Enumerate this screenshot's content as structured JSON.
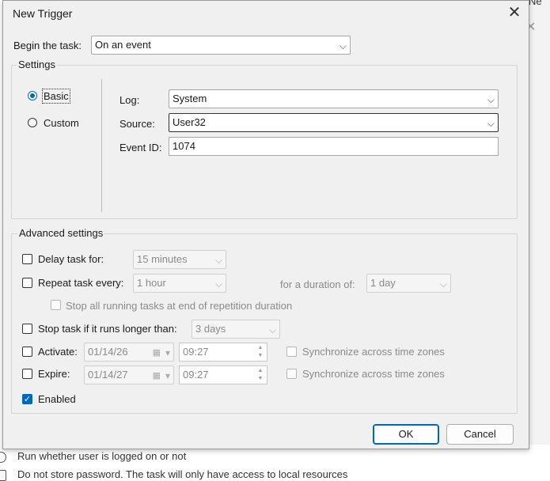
{
  "dialog": {
    "title": "New Trigger",
    "close_label": "✕",
    "begin_task_label": "Begin the task:",
    "begin_task_value": "On an event"
  },
  "settings": {
    "group_label": "Settings",
    "radio_basic": "Basic",
    "radio_custom": "Custom",
    "log_label": "Log:",
    "log_value": "System",
    "source_label": "Source:",
    "source_value": "User32",
    "event_id_label": "Event ID:",
    "event_id_value": "1074"
  },
  "advanced": {
    "group_label": "Advanced settings",
    "delay_label": "Delay task for:",
    "delay_value": "15 minutes",
    "repeat_label": "Repeat task every:",
    "repeat_value": "1 hour",
    "duration_label": "for a duration of:",
    "duration_value": "1 day",
    "stop_running_label": "Stop all running tasks at end of repetition duration",
    "stop_longer_label": "Stop task if it runs longer than:",
    "stop_longer_value": "3 days",
    "activate_label": "Activate:",
    "activate_date": "01/14/26",
    "activate_time": "09:27",
    "expire_label": "Expire:",
    "expire_date": "01/14/27",
    "expire_time": "09:27",
    "sync_label": "Synchronize across time zones",
    "enabled_label": "Enabled",
    "enabled_checked": true
  },
  "buttons": {
    "ok": "OK",
    "cancel": "Cancel"
  },
  "background": {
    "run_whether_text": "Run whether user is logged on or not",
    "do_not_store_text": "Do not store password.  The task will only have access to local resources",
    "corner_text": "Ne"
  },
  "icons": {
    "chevron": "chevron-down-icon",
    "calendar": "calendar-icon",
    "check": "checkmark-icon"
  },
  "colors": {
    "accent": "#0067c0",
    "dialog_bg": "#f0f0f0"
  }
}
